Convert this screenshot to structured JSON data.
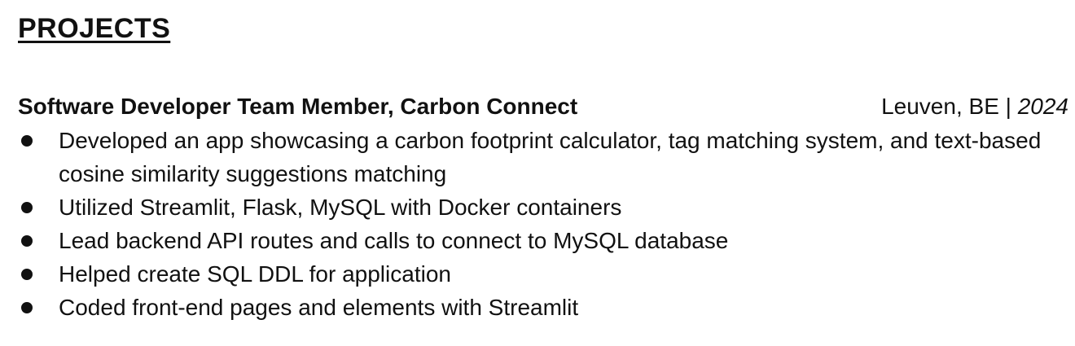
{
  "section": {
    "title": "PROJECTS"
  },
  "entry": {
    "role": "Software Developer Team Member, Carbon Connect",
    "location": "Leuven, BE | ",
    "year": "2024"
  },
  "bullets": [
    {
      "text": "Developed an app showcasing a carbon footprint calculator, tag matching system, and text-based cosine similarity suggestions matching"
    },
    {
      "text": "Utilized Streamlit, Flask, MySQL with Docker containers"
    },
    {
      "text": "Lead backend API routes and calls to connect to MySQL database"
    },
    {
      "text": "Helped create SQL DDL for application"
    },
    {
      "text": "Coded front-end pages and elements with Streamlit"
    }
  ]
}
